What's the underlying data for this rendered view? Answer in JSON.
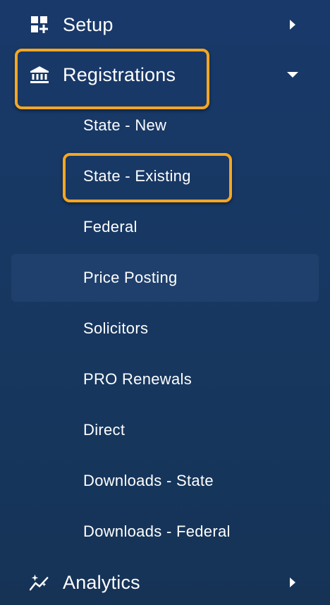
{
  "menu": {
    "setup": {
      "label": "Setup",
      "icon": "dashboard-plus-icon",
      "caret": "chevron-right-icon"
    },
    "registrations": {
      "label": "Registrations",
      "icon": "bank-icon",
      "caret": "caret-down-icon",
      "highlighted": true,
      "items": [
        {
          "label": "State - New"
        },
        {
          "label": "State - Existing",
          "highlighted": true
        },
        {
          "label": "Federal"
        },
        {
          "label": "Price Posting",
          "active": true
        },
        {
          "label": "Solicitors"
        },
        {
          "label": "PRO Renewals"
        },
        {
          "label": "Direct"
        },
        {
          "label": "Downloads - State"
        },
        {
          "label": "Downloads - Federal"
        }
      ]
    },
    "analytics": {
      "label": "Analytics",
      "icon": "sparkle-chart-icon",
      "caret": "chevron-right-icon"
    }
  },
  "colors": {
    "background": "#18396a",
    "active_item": "#1f406c",
    "highlight_border": "#f5a623",
    "text": "#ffffff"
  }
}
